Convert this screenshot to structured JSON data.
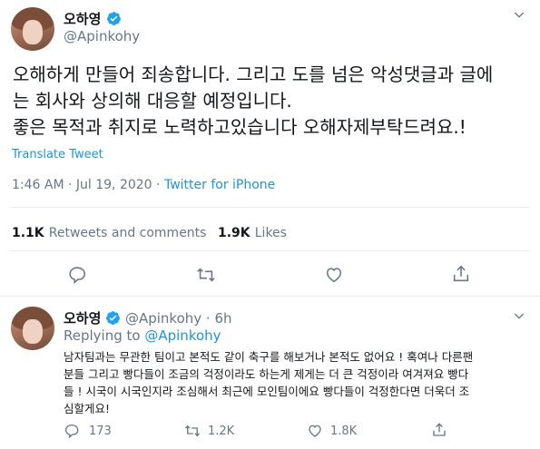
{
  "main_tweet": {
    "author_name": "오하영",
    "author_handle": "@Apinkohy",
    "text_lines": [
      "오해하게 만들어 죄송합니다. 그리고 도를 넘은 악성댓글과 글에",
      "는 회사와 상의해 대응할 예정입니다.",
      "좋은 목적과 취지로 노력하고있습니다 오해자제부탁드려요.!"
    ],
    "translate_label": "Translate Tweet",
    "time": "1:46 AM · Jul 19, 2020",
    "separator": " · ",
    "source": "Twitter for iPhone",
    "retweets_count": "1.1K",
    "retweets_label": "Retweets and comments",
    "likes_count": "1.9K",
    "likes_label": "Likes"
  },
  "reply_tweet": {
    "author_name": "오하영",
    "author_handle": "@Apinkohy",
    "time": "· 6h",
    "replying_prefix": "Replying to",
    "replying_to": "@Apinkohy",
    "text_lines": [
      "남자팀과는 무관한 팀이고 본적도 같이 축구를 해보거나 본적도 없어요 ! 혹여나 다른팬",
      "분들 그리고 빵다들이 조금의 걱정이라도 하는게 제게는 더 큰 걱정이라 여겨져요 빵다",
      "들 ! 시국이 시국인지라 조심해서 최근에 모인팀이에요 빵다들이 걱정한다면 더욱더 조",
      "심할게요!"
    ],
    "reply_count": "173",
    "retweet_count": "1.2K",
    "like_count": "1.8K"
  },
  "colors": {
    "link_blue": "#1b95e0",
    "secondary_text": "#657786",
    "verified_blue": "#1da1f2",
    "divider": "#e6ecf0"
  },
  "icons": [
    "verified-badge-icon",
    "chevron-down-icon",
    "reply-icon",
    "retweet-icon",
    "like-icon",
    "share-icon"
  ]
}
